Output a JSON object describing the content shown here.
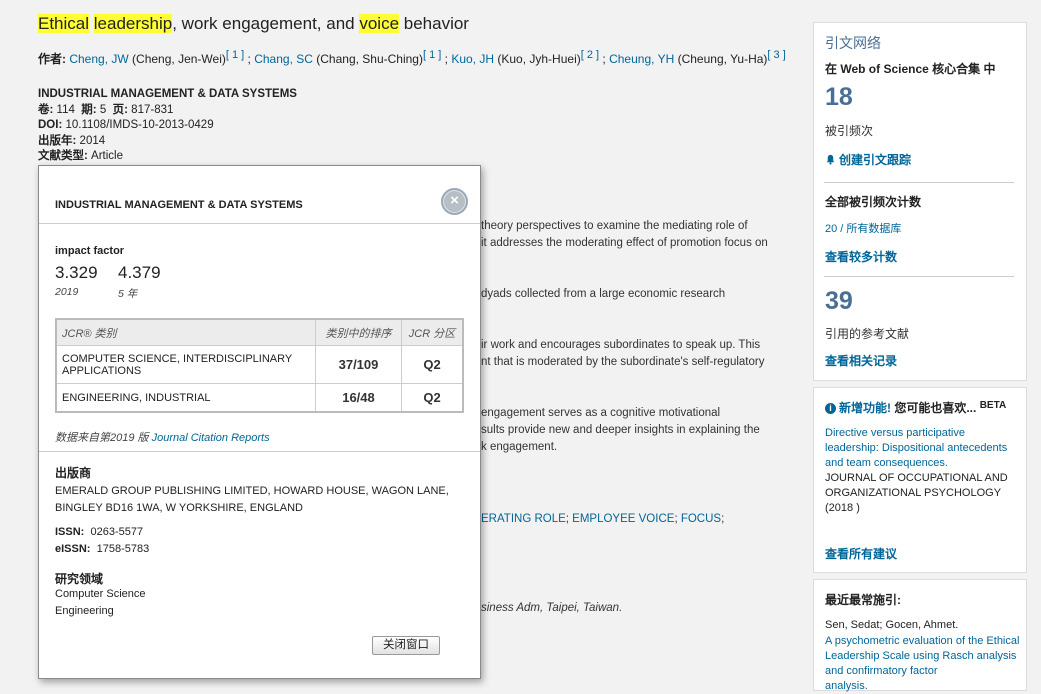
{
  "record": {
    "title_parts": [
      "Ethical",
      " ",
      "leadership",
      ", work engagement, and ",
      "voice",
      " behavior"
    ],
    "authors_label": "作者:",
    "authors": [
      {
        "short": "Cheng, JW",
        "full": " (Cheng, Jen-Wei)",
        "ref": "[ 1 ]",
        "sep": " ; "
      },
      {
        "short": "Chang, SC",
        "full": " (Chang, Shu-Ching)",
        "ref": "[ 1 ]",
        "sep": " ; "
      },
      {
        "short": "Kuo, JH",
        "full": " (Kuo, Jyh-Huei)",
        "ref": "[ 2 ]",
        "sep": " ; "
      },
      {
        "short": "Cheung, YH",
        "full": " (Cheung, Yu-Ha)",
        "ref": "[ 3 ]",
        "sep": ""
      }
    ],
    "journal": "INDUSTRIAL MANAGEMENT & DATA SYSTEMS",
    "volume_label": "卷:",
    "volume": "114",
    "issue_label": "期:",
    "issue": "5",
    "pages_label": "页:",
    "pages": "817-831",
    "doi_label": "DOI:",
    "doi": "10.1108/IMDS-10-2013-0429",
    "year_label": "出版年:",
    "year": "2014",
    "doctype_label": "文献类型:",
    "doctype": "Article"
  },
  "background_text": {
    "l1": "theory perspectives to examine the mediating role of",
    "l2": "it addresses the moderating effect of promotion focus on",
    "l3": "dyads collected from a large economic research",
    "l4": "ir work and encourages subordinates to speak up. This",
    "l5": "nt that is moderated by the subordinate's self-regulatory",
    "l6": "engagement serves as a cognitive motivational",
    "l7": "sults provide new and deeper insights in explaining the",
    "l8": "k engagement.",
    "kw1": "ERATING ROLE",
    "kw_sep1": "; ",
    "kw2": "EMPLOYEE VOICE",
    "kw_sep2": "; ",
    "kw3": "FOCUS",
    "kw_end": ";",
    "addr": "siness Adm, Taipei, Taiwan."
  },
  "popup": {
    "journal": "INDUSTRIAL MANAGEMENT & DATA SYSTEMS",
    "close_icon": "close-icon",
    "if_label": "impact factor",
    "if_values": [
      {
        "value": "3.329",
        "period": "2019"
      },
      {
        "value": "4.379",
        "period": "5 年"
      }
    ],
    "jcr_headers": [
      "JCR® 类别",
      "类别中的排序",
      "JCR 分区"
    ],
    "jcr_rows": [
      {
        "category": "COMPUTER SCIENCE, INTERDISCIPLINARY APPLICATIONS",
        "rank": "37/109",
        "quartile": "Q2"
      },
      {
        "category": "ENGINEERING, INDUSTRIAL",
        "rank": "16/48",
        "quartile": "Q2"
      }
    ],
    "source_prefix": "数据来自第2019 版 ",
    "source_link": "Journal Citation Reports",
    "publisher_label": "出版商",
    "publisher": "EMERALD GROUP PUBLISHING LIMITED, HOWARD HOUSE, WAGON LANE, BINGLEY BD16 1WA, W YORKSHIRE, ENGLAND",
    "issn_label": "ISSN:",
    "issn": "0263-5577",
    "eissn_label": "eISSN:",
    "eissn": "1758-5783",
    "research_label": "研究领域",
    "research_areas": [
      "Computer Science",
      "Engineering"
    ],
    "close_button": "关闭窗口"
  },
  "sidebar": {
    "network_title": "引文网络",
    "network_sub": "在 Web of Science 核心合集 中",
    "times_cited": "18",
    "times_cited_label": "被引频次",
    "alert_icon": "bell-icon",
    "create_alert": "创建引文跟踪",
    "all_counts_label": "全部被引频次计数",
    "all_counts_partial": "20 / 所有数据库",
    "more_counts": "查看较多计数",
    "references": "39",
    "references_label": "引用的参考文献",
    "related": "查看相关记录",
    "new_feature_icon": "info-icon",
    "new_feature_title": "新增功能!",
    "new_feature_title_rest": " 您可能也喜欢...",
    "beta": "BETA",
    "rec_article": "Directive versus participative leadership: Dispositional antecedents and team consequences.",
    "rec_journal": "JOURNAL OF OCCUPATIONAL AND ORGANIZATIONAL PSYCHOLOGY",
    "rec_year": "(2018 )",
    "see_all": "查看所有建议",
    "recent_title": "最近最常施引:",
    "recent_authors": "Sen, Sedat; Gocen, Ahmet.",
    "recent_article": "A psychometric evaluation of the Ethical Leadership Scale using Rasch analysis and confirmatory factor",
    "recent_cut": "analysis."
  }
}
